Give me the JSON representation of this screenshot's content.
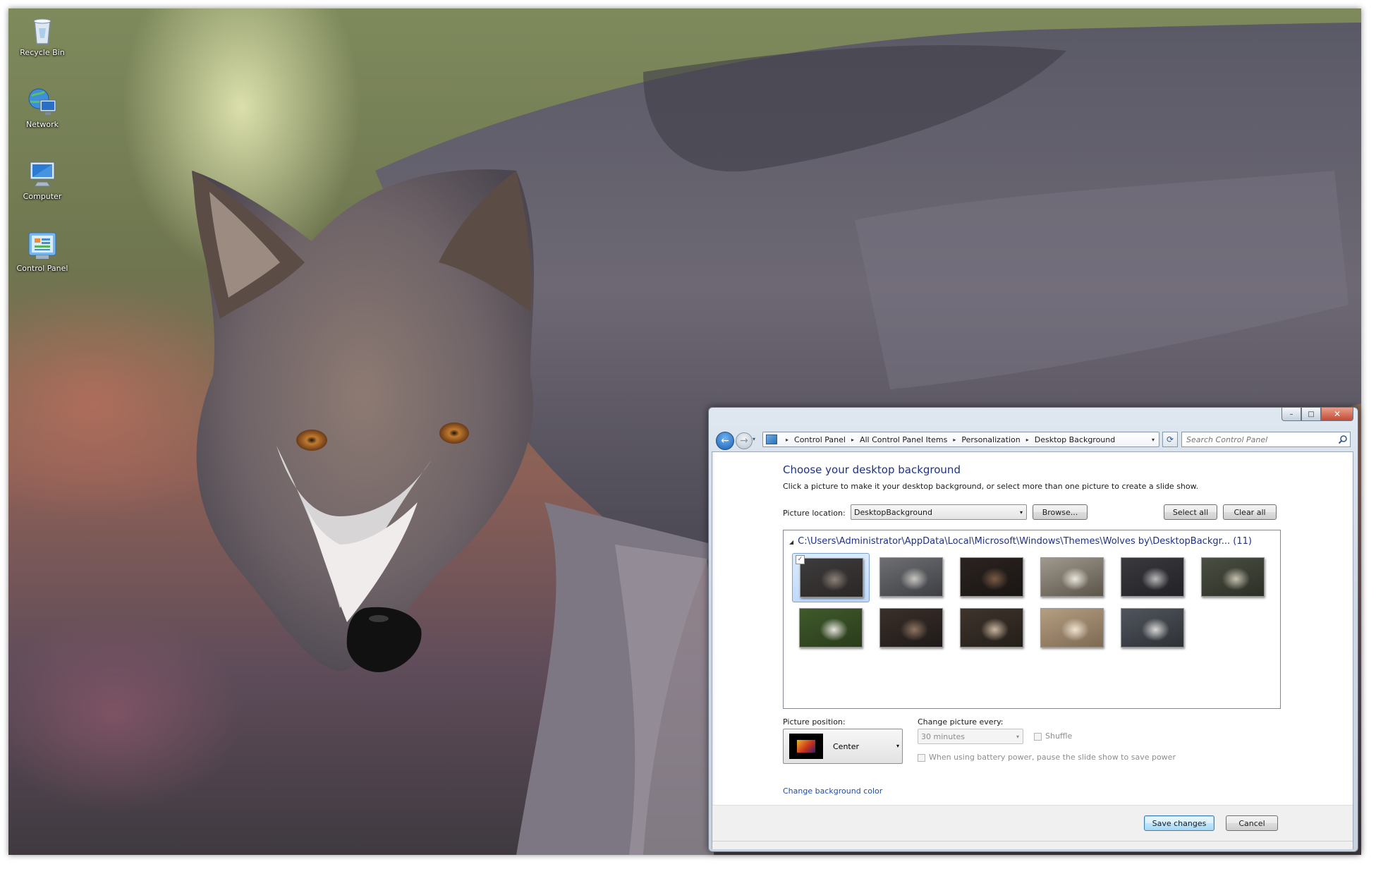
{
  "desktop": {
    "icons": [
      {
        "label": "Recycle Bin",
        "icon": "recycle-bin-icon"
      },
      {
        "label": "Network",
        "icon": "network-icon"
      },
      {
        "label": "Computer",
        "icon": "computer-icon"
      },
      {
        "label": "Control Panel",
        "icon": "control-panel-icon"
      }
    ]
  },
  "window": {
    "caption_buttons": {
      "minimize": "–",
      "maximize": "□",
      "close": "✕"
    },
    "nav": {
      "back": "←",
      "forward": "→",
      "recent": "▾"
    },
    "breadcrumb": [
      "Control Panel",
      "All Control Panel Items",
      "Personalization",
      "Desktop Background"
    ],
    "breadcrumb_separator": "▸",
    "address_dropdown": "▾",
    "refresh": "⟳",
    "search_placeholder": "Search Control Panel",
    "title": "Choose your desktop background",
    "subtitle": "Click a picture to make it your desktop background, or select more than one picture to create a slide show.",
    "picture_location_label": "Picture location:",
    "picture_location_value": "DesktopBackground",
    "browse_label": "Browse...",
    "select_all_label": "Select all",
    "clear_all_label": "Clear all",
    "group_toggle": "◢",
    "group_header": "C:\\Users\\Administrator\\AppData\\Local\\Microsoft\\Windows\\Themes\\Wolves by\\DesktopBackgr... (11)",
    "thumbnails": [
      {
        "selected": true,
        "checked": true,
        "palette": [
          "#3d3b3c",
          "#8e8178",
          "#2c2726"
        ]
      },
      {
        "selected": false,
        "checked": false,
        "palette": [
          "#6e6f73",
          "#c9c6c1",
          "#3d3f44"
        ]
      },
      {
        "selected": false,
        "checked": false,
        "palette": [
          "#2b2320",
          "#7a5c45",
          "#191513"
        ]
      },
      {
        "selected": false,
        "checked": false,
        "palette": [
          "#a09a8e",
          "#ece8e0",
          "#5b5448"
        ]
      },
      {
        "selected": false,
        "checked": false,
        "palette": [
          "#3a3a3e",
          "#b9b8bb",
          "#222226"
        ]
      },
      {
        "selected": false,
        "checked": false,
        "palette": [
          "#4a4f42",
          "#c8c2b1",
          "#2c2f26"
        ]
      },
      {
        "selected": false,
        "checked": false,
        "palette": [
          "#3f5a2a",
          "#e6e4df",
          "#2a3b1c"
        ]
      },
      {
        "selected": false,
        "checked": false,
        "palette": [
          "#3a2f2a",
          "#8f7463",
          "#1f1a18"
        ]
      },
      {
        "selected": false,
        "checked": false,
        "palette": [
          "#3e342c",
          "#c9b6a0",
          "#241e19"
        ]
      },
      {
        "selected": false,
        "checked": false,
        "palette": [
          "#b59e80",
          "#efe4d2",
          "#7d6a54"
        ]
      },
      {
        "selected": false,
        "checked": false,
        "palette": [
          "#50555d",
          "#d8d8d6",
          "#2e3136"
        ]
      }
    ],
    "checkmark": "✓",
    "picture_position_label": "Picture position:",
    "picture_position_value": "Center",
    "change_every_label": "Change picture every:",
    "change_every_value": "30 minutes",
    "shuffle_label": "Shuffle",
    "battery_label": "When using battery power, pause the slide show to save power",
    "change_bg_color_link": "Change background color",
    "save_label": "Save changes",
    "cancel_label": "Cancel",
    "dropdown_arrow": "▾"
  }
}
